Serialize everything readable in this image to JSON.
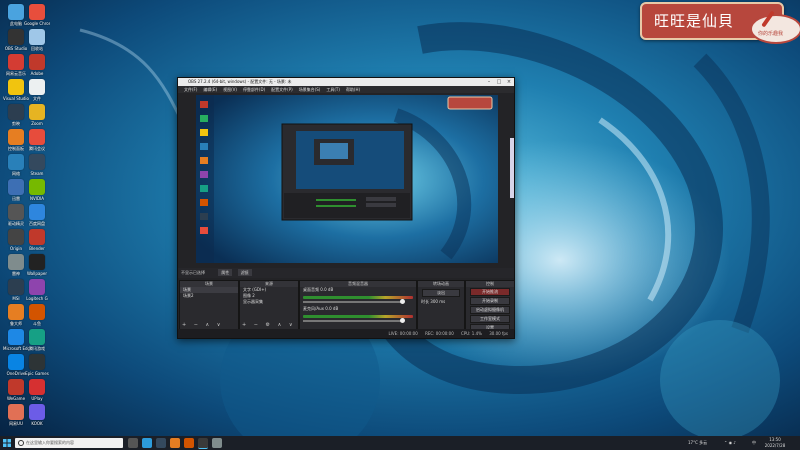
{
  "desktop": {
    "icons": [
      {
        "label": "此电脑",
        "color": "#4aa3df"
      },
      {
        "label": "Google Chrome",
        "color": "#e84e3c"
      },
      {
        "label": "OBS Studio",
        "color": "#333333"
      },
      {
        "label": "回收站",
        "color": "#9fc7e8"
      },
      {
        "label": "网易云音乐",
        "color": "#d43c33"
      },
      {
        "label": "Adobe",
        "color": "#c0392b"
      },
      {
        "label": "Visual Studio",
        "color": "#f1c40f"
      },
      {
        "label": "文件",
        "color": "#ecf0f1"
      },
      {
        "label": "剪映",
        "color": "#2c3e50"
      },
      {
        "label": "Zoom",
        "color": "#e6b422"
      },
      {
        "label": "控制面板",
        "color": "#e67e22"
      },
      {
        "label": "腾讯会议",
        "color": "#e74c3c"
      },
      {
        "label": "网络",
        "color": "#2980b9"
      },
      {
        "label": "Steam",
        "color": "#34495e"
      },
      {
        "label": "迅雷",
        "color": "#3d6fb4"
      },
      {
        "label": "NVIDIA",
        "color": "#76b900"
      },
      {
        "label": "驱动精灵",
        "color": "#555555"
      },
      {
        "label": "百度网盘",
        "color": "#2e86de"
      },
      {
        "label": "Origin",
        "color": "#444444"
      },
      {
        "label": "Blender",
        "color": "#c0392b"
      },
      {
        "label": "雷神",
        "color": "#7f8c8d"
      },
      {
        "label": "Wallpaper",
        "color": "#222222"
      },
      {
        "label": "MSI",
        "color": "#2c3e50"
      },
      {
        "label": "Logitech G",
        "color": "#8e44ad"
      },
      {
        "label": "鲁大师",
        "color": "#e67e22"
      },
      {
        "label": "斗鱼",
        "color": "#d35400"
      },
      {
        "label": "Microsoft Edge",
        "color": "#1e88e5"
      },
      {
        "label": "腾讯游戏",
        "color": "#16a085"
      },
      {
        "label": "OneDrive",
        "color": "#0984e3"
      },
      {
        "label": "Epic Games",
        "color": "#2d3436"
      },
      {
        "label": "WeGame",
        "color": "#c0392b"
      },
      {
        "label": "UPlay",
        "color": "#d63031"
      },
      {
        "label": "网易UU",
        "color": "#e17055"
      },
      {
        "label": "KOOK",
        "color": "#6c5ce7"
      }
    ]
  },
  "badge": {
    "title": "旺旺是仙貝",
    "sub": "你的乐趣我"
  },
  "obs": {
    "title": "OBS 27.2.4 (64-bit, windows) - 配置文件: 无 - 场景: 未",
    "menu": [
      "文件(F)",
      "编辑(E)",
      "视图(V)",
      "停靠部件(D)",
      "配置文件(P)",
      "场景集合(S)",
      "工具(T)",
      "帮助(H)"
    ],
    "source_bar": [
      "不显示已选择",
      "属性",
      "滤镜"
    ],
    "docks": {
      "scenes": {
        "header": "场景",
        "items": [
          "场景",
          "场景2"
        ]
      },
      "sources": {
        "header": "来源",
        "items": [
          "文字 (GDI+)",
          "图像 2",
          "显示器采集"
        ]
      },
      "mixer": {
        "header": "音频混音器",
        "tracks": [
          {
            "name": "桌面音频",
            "db": "0.0 dB"
          },
          {
            "name": "麦克风/Aux",
            "db": "0.0 dB"
          }
        ]
      },
      "transitions": {
        "header": "转场动画",
        "type": "淡出",
        "duration_label": "时长",
        "duration": "300 ms"
      },
      "controls": {
        "header": "控制",
        "buttons": [
          "开始推流",
          "开始录制",
          "启动虚拟摄像机",
          "工作室模式",
          "设置",
          "退出"
        ]
      }
    },
    "status": [
      "LIVE: 00:00:00",
      "REC: 00:00:00",
      "CPU: 1.4%",
      "30.00 fps"
    ]
  },
  "taskbar": {
    "search_placeholder": "在这里输入你要搜索的内容",
    "weather": "17°C 多云",
    "time": "13:50",
    "date": "2022/7/28",
    "lang": "中"
  }
}
